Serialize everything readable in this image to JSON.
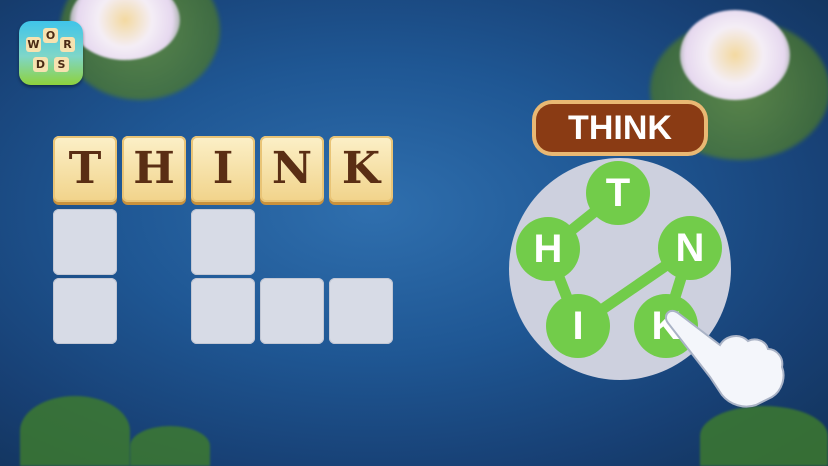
{
  "logo": {
    "letters": [
      "W",
      "O",
      "R",
      "D",
      "S"
    ]
  },
  "board": {
    "solved_word": [
      "T",
      "H",
      "I",
      "N",
      "K"
    ],
    "empty_row_1": [
      true,
      false,
      true,
      false,
      false
    ],
    "empty_row_2": [
      true,
      false,
      true,
      true,
      true
    ]
  },
  "current_word": "THINK",
  "wheel": {
    "letters": [
      "T",
      "H",
      "N",
      "I",
      "K"
    ],
    "path": [
      "T",
      "H",
      "I",
      "N",
      "K"
    ]
  },
  "colors": {
    "node": "#72cc4a",
    "banner": "#8a3b14",
    "wheel": "#cdd0de"
  }
}
